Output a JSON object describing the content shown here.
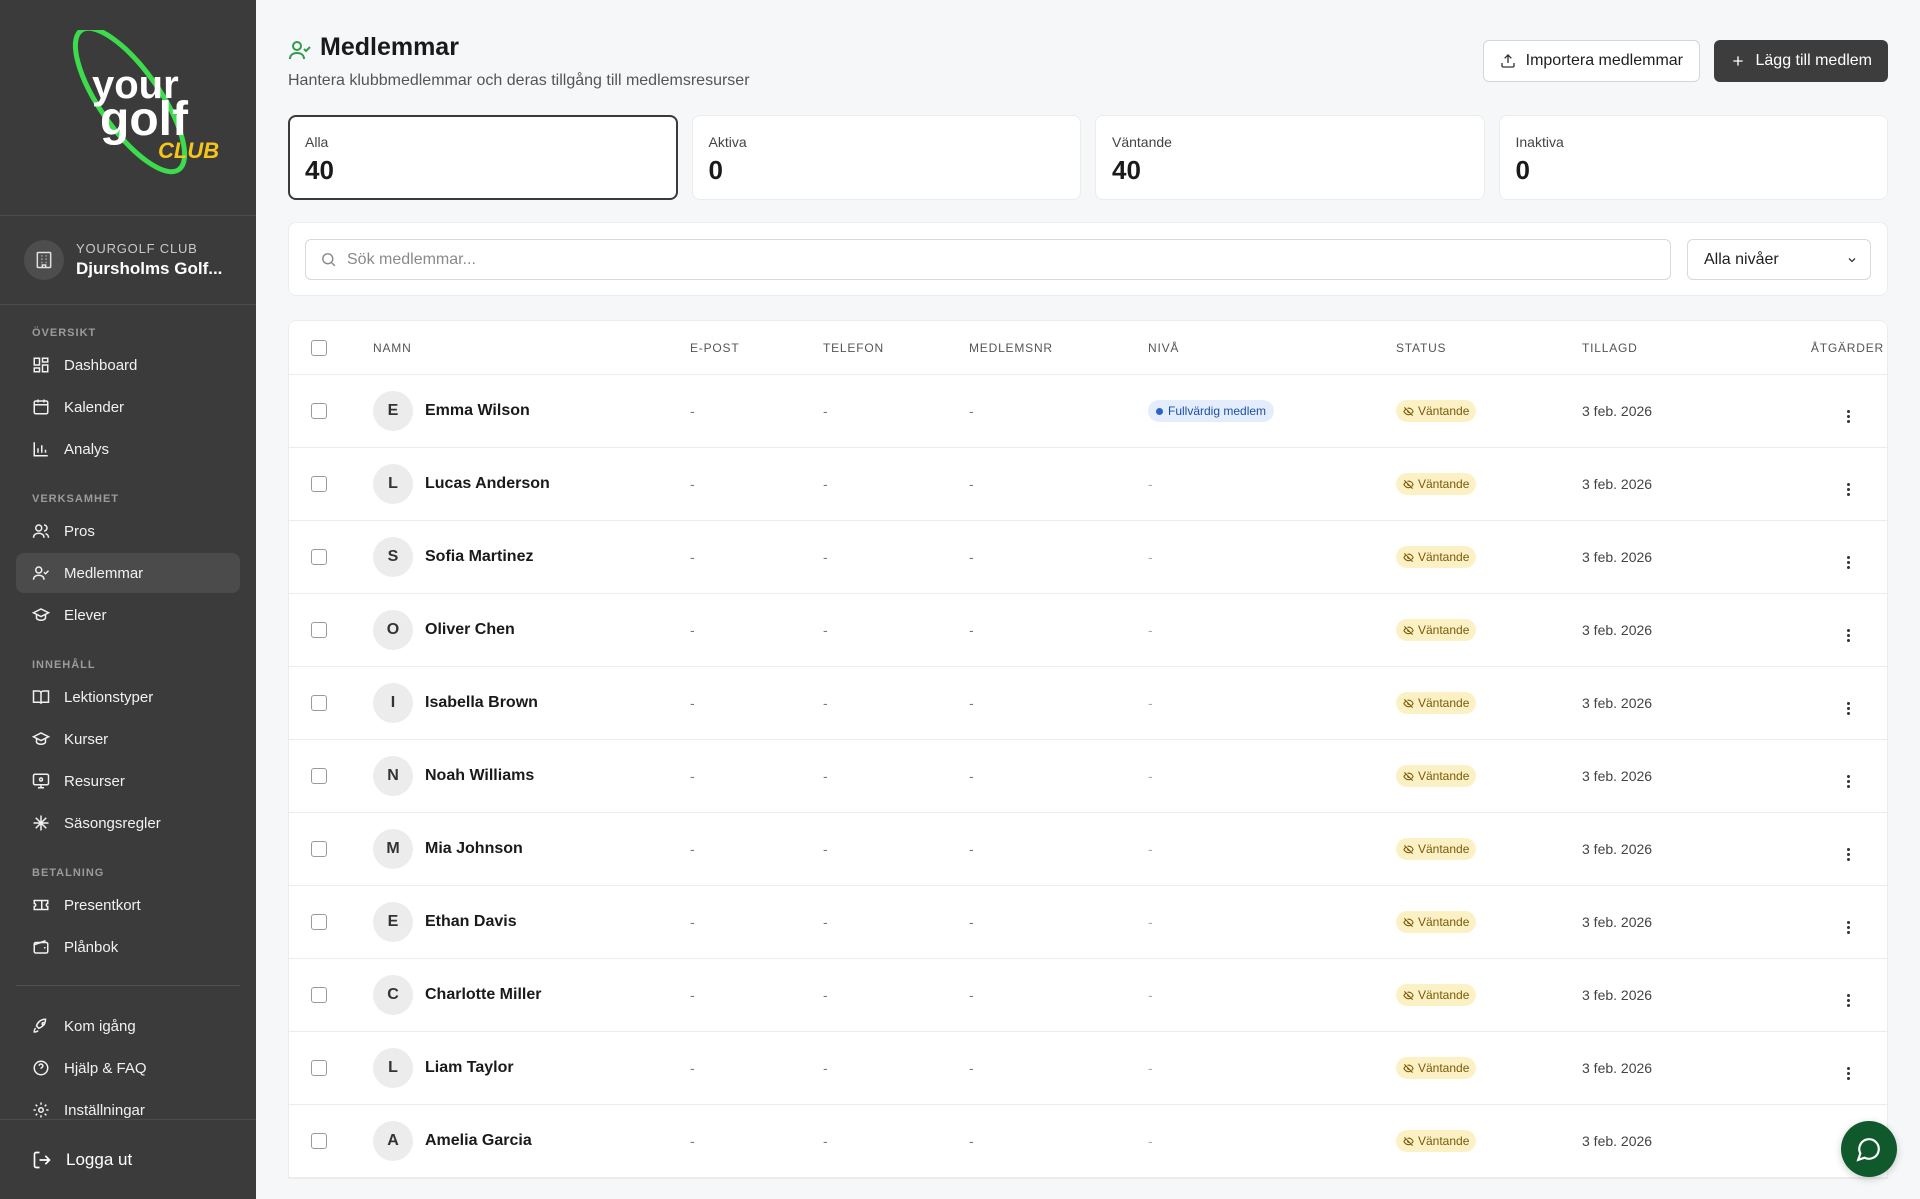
{
  "brand": {
    "logo_line1": "your",
    "logo_line2": "golf",
    "logo_line3": "CLUB",
    "colors": {
      "logo_green": "#3ddc4c",
      "logo_yellow": "#f5c518",
      "sidebar_bg": "#3b3b3b",
      "chat_green": "#10592d"
    }
  },
  "club": {
    "label": "YOURGOLF CLUB",
    "name": "Djursholms Golf..."
  },
  "nav": {
    "sections": [
      {
        "title": "ÖVERSIKT",
        "items": [
          {
            "label": "Dashboard",
            "icon": "dashboard-icon"
          },
          {
            "label": "Kalender",
            "icon": "calendar-icon"
          },
          {
            "label": "Analys",
            "icon": "chart-icon"
          }
        ]
      },
      {
        "title": "VERKSAMHET",
        "items": [
          {
            "label": "Pros",
            "icon": "users-icon"
          },
          {
            "label": "Medlemmar",
            "icon": "user-check-icon"
          },
          {
            "label": "Elever",
            "icon": "graduation-cap-icon"
          }
        ]
      },
      {
        "title": "INNEHÅLL",
        "items": [
          {
            "label": "Lektionstyper",
            "icon": "book-icon"
          },
          {
            "label": "Kurser",
            "icon": "graduation-cap-icon"
          },
          {
            "label": "Resurser",
            "icon": "monitor-icon"
          },
          {
            "label": "Säsongsregler",
            "icon": "snowflake-icon"
          }
        ]
      },
      {
        "title": "BETALNING",
        "items": [
          {
            "label": "Presentkort",
            "icon": "ticket-icon"
          },
          {
            "label": "Plånbok",
            "icon": "wallet-icon"
          }
        ]
      }
    ],
    "bottom": [
      {
        "label": "Kom igång",
        "icon": "rocket-icon"
      },
      {
        "label": "Hjälp & FAQ",
        "icon": "help-icon"
      },
      {
        "label": "Inställningar",
        "icon": "gear-icon"
      }
    ],
    "active": "Medlemmar",
    "logout": "Logga ut"
  },
  "header": {
    "title": "Medlemmar",
    "subtitle": "Hantera klubbmedlemmar och deras tillgång till medlemsresurser",
    "import_label": "Importera medlemmar",
    "add_label": "Lägg till medlem"
  },
  "stats": [
    {
      "label": "Alla",
      "value": "40",
      "selected": true
    },
    {
      "label": "Aktiva",
      "value": "0"
    },
    {
      "label": "Väntande",
      "value": "40"
    },
    {
      "label": "Inaktiva",
      "value": "0"
    }
  ],
  "filters": {
    "search_placeholder": "Sök medlemmar...",
    "level_select": "Alla nivåer"
  },
  "table": {
    "columns": [
      "NAMN",
      "E-POST",
      "TELEFON",
      "MEDLEMSNR",
      "NIVÅ",
      "STATUS",
      "TILLAGD",
      "ÅTGÄRDER"
    ],
    "rows": [
      {
        "initial": "E",
        "name": "Emma Wilson",
        "email": "-",
        "phone": "-",
        "number": "-",
        "level": "Fullvärdig medlem",
        "status": "Väntande",
        "added": "3 feb. 2026"
      },
      {
        "initial": "L",
        "name": "Lucas Anderson",
        "email": "-",
        "phone": "-",
        "number": "-",
        "level": "-",
        "status": "Väntande",
        "added": "3 feb. 2026"
      },
      {
        "initial": "S",
        "name": "Sofia Martinez",
        "email": "-",
        "phone": "-",
        "number": "-",
        "level": "-",
        "status": "Väntande",
        "added": "3 feb. 2026"
      },
      {
        "initial": "O",
        "name": "Oliver Chen",
        "email": "-",
        "phone": "-",
        "number": "-",
        "level": "-",
        "status": "Väntande",
        "added": "3 feb. 2026"
      },
      {
        "initial": "I",
        "name": "Isabella Brown",
        "email": "-",
        "phone": "-",
        "number": "-",
        "level": "-",
        "status": "Väntande",
        "added": "3 feb. 2026"
      },
      {
        "initial": "N",
        "name": "Noah Williams",
        "email": "-",
        "phone": "-",
        "number": "-",
        "level": "-",
        "status": "Väntande",
        "added": "3 feb. 2026"
      },
      {
        "initial": "M",
        "name": "Mia Johnson",
        "email": "-",
        "phone": "-",
        "number": "-",
        "level": "-",
        "status": "Väntande",
        "added": "3 feb. 2026"
      },
      {
        "initial": "E",
        "name": "Ethan Davis",
        "email": "-",
        "phone": "-",
        "number": "-",
        "level": "-",
        "status": "Väntande",
        "added": "3 feb. 2026"
      },
      {
        "initial": "C",
        "name": "Charlotte Miller",
        "email": "-",
        "phone": "-",
        "number": "-",
        "level": "-",
        "status": "Väntande",
        "added": "3 feb. 2026"
      },
      {
        "initial": "L",
        "name": "Liam Taylor",
        "email": "-",
        "phone": "-",
        "number": "-",
        "level": "-",
        "status": "Väntande",
        "added": "3 feb. 2026"
      },
      {
        "initial": "A",
        "name": "Amelia Garcia",
        "email": "-",
        "phone": "-",
        "number": "-",
        "level": "-",
        "status": "Väntande",
        "added": "3 feb. 2026"
      }
    ]
  }
}
